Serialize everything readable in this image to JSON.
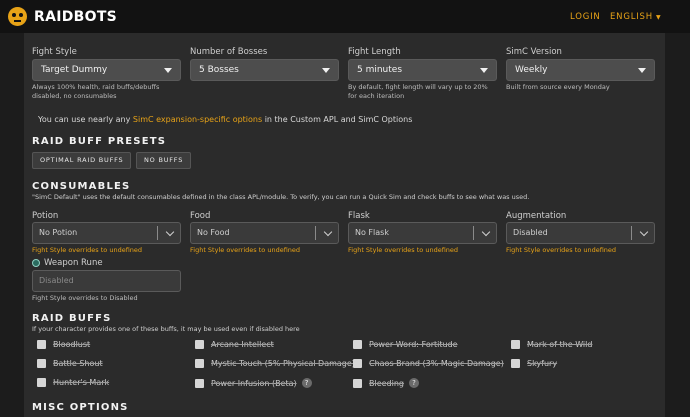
{
  "header": {
    "brand": "RAIDBOTS",
    "login": "LOGIN",
    "language": "ENGLISH"
  },
  "sim_options": {
    "fight_style": {
      "label": "Fight Style",
      "value": "Target Dummy",
      "help": "Always 100% health, raid buffs/debuffs disabled, no consumables"
    },
    "num_bosses": {
      "label": "Number of Bosses",
      "value": "5 Bosses"
    },
    "fight_length": {
      "label": "Fight Length",
      "value": "5 minutes",
      "help": "By default, fight length will vary up to 20% for each iteration"
    },
    "simc_version": {
      "label": "SimC Version",
      "value": "Weekly",
      "help": "Built from source every Monday"
    },
    "info_before": "You can use nearly any ",
    "info_link": "SimC expansion-specific options",
    "info_after": " in the Custom APL and SimC Options"
  },
  "raid_buff_presets": {
    "title": "RAID BUFF PRESETS",
    "optimal": "OPTIMAL RAID BUFFS",
    "none": "NO BUFFS"
  },
  "consumables": {
    "title": "CONSUMABLES",
    "note": "\"SimC Default\" uses the default consumables defined in the class APL/module. To verify, you can run a Quick Sim and check buffs to see what was used.",
    "potion": {
      "label": "Potion",
      "value": "No Potion",
      "override": "Fight Style overrides to undefined"
    },
    "food": {
      "label": "Food",
      "value": "No Food",
      "override": "Fight Style overrides to undefined"
    },
    "flask": {
      "label": "Flask",
      "value": "No Flask",
      "override": "Fight Style overrides to undefined"
    },
    "augmentation": {
      "label": "Augmentation",
      "value": "Disabled",
      "override": "Fight Style overrides to undefined"
    },
    "weapon_rune": {
      "label": "Weapon Rune",
      "value": "Disabled",
      "override": "Fight Style overrides to Disabled"
    }
  },
  "raid_buffs": {
    "title": "RAID BUFFS",
    "note": "If your character provides one of these buffs, it may be used even if disabled here",
    "items": [
      {
        "label": "Bloodlust",
        "checked": false
      },
      {
        "label": "Arcane Intellect",
        "checked": false
      },
      {
        "label": "Power Word: Fortitude",
        "checked": false
      },
      {
        "label": "Mark of the Wild",
        "checked": false
      },
      {
        "label": "Battle Shout",
        "checked": false
      },
      {
        "label": "Mystic Touch (5% Physical Damage)",
        "checked": false
      },
      {
        "label": "Chaos Brand (3% Magic Damage)",
        "checked": false
      },
      {
        "label": "Skyfury",
        "checked": false
      },
      {
        "label": "Hunter's Mark",
        "checked": false
      },
      {
        "label": "Power Infusion (Beta)",
        "checked": false
      },
      {
        "label": "Bleeding",
        "checked": false
      }
    ],
    "help_glyph": "?"
  },
  "misc": {
    "title": "MISC OPTIONS"
  }
}
